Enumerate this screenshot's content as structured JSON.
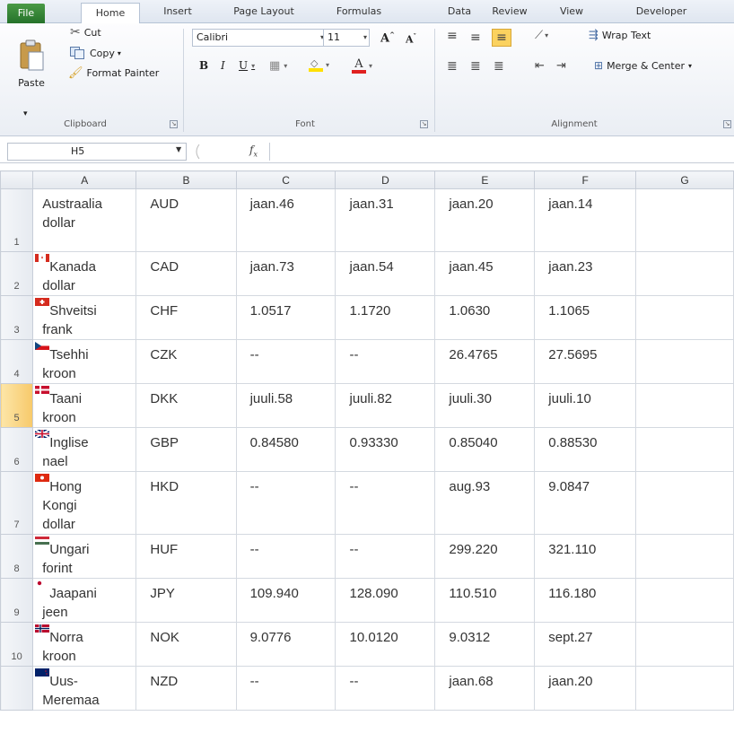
{
  "tabs": [
    "File",
    "Home",
    "Insert",
    "Page Layout",
    "Formulas",
    "Data",
    "Review",
    "View",
    "Developer"
  ],
  "clipboard": {
    "paste": "Paste",
    "cut": "Cut",
    "copy": "Copy",
    "format_painter": "Format Painter",
    "label": "Clipboard"
  },
  "font": {
    "name": "Calibri",
    "size": "11",
    "label": "Font"
  },
  "alignment": {
    "wrap": "Wrap Text",
    "merge": "Merge & Center",
    "label": "Alignment"
  },
  "formula_bar": {
    "name_box": "H5",
    "fx": "fx",
    "formula": ""
  },
  "columns": [
    "A",
    "B",
    "C",
    "D",
    "E",
    "F",
    "G"
  ],
  "selected_cell": {
    "column": "H",
    "row": 5
  },
  "rows": [
    {
      "num": "1",
      "flag": "",
      "name": [
        "Austraalia",
        "dollar"
      ],
      "code": "AUD",
      "c": "jaan.46",
      "d": "jaan.31",
      "e": "jaan.20",
      "f": "jaan.14"
    },
    {
      "num": "2",
      "flag": "ca",
      "name": [
        "Kanada",
        "dollar"
      ],
      "code": "CAD",
      "c": "jaan.73",
      "d": "jaan.54",
      "e": "jaan.45",
      "f": "jaan.23"
    },
    {
      "num": "3",
      "flag": "ch",
      "name": [
        "Shveitsi",
        "frank"
      ],
      "code": "CHF",
      "c": "1.0517",
      "d": "1.1720",
      "e": "1.0630",
      "f": "1.1065"
    },
    {
      "num": "4",
      "flag": "cz",
      "name": [
        "Tsehhi",
        "kroon"
      ],
      "code": "CZK",
      "c": "--",
      "d": "--",
      "e": "26.4765",
      "f": "27.5695"
    },
    {
      "num": "5",
      "flag": "dk",
      "name": [
        "Taani",
        "kroon"
      ],
      "code": "DKK",
      "c": "juuli.58",
      "d": "juuli.82",
      "e": "juuli.30",
      "f": "juuli.10"
    },
    {
      "num": "6",
      "flag": "gb",
      "name": [
        "Inglise",
        "nael"
      ],
      "code": "GBP",
      "c": "0.84580",
      "d": "0.93330",
      "e": "0.85040",
      "f": "0.88530"
    },
    {
      "num": "7",
      "flag": "hk",
      "name": [
        "Hong",
        "Kongi",
        "dollar"
      ],
      "code": "HKD",
      "c": "--",
      "d": "--",
      "e": "aug.93",
      "f": "9.0847"
    },
    {
      "num": "8",
      "flag": "hu",
      "name": [
        "Ungari",
        "forint"
      ],
      "code": "HUF",
      "c": "--",
      "d": "--",
      "e": "299.220",
      "f": "321.110"
    },
    {
      "num": "9",
      "flag": "jp",
      "name": [
        "Jaapani",
        "jeen"
      ],
      "code": "JPY",
      "c": "109.940",
      "d": "128.090",
      "e": "110.510",
      "f": "116.180"
    },
    {
      "num": "10",
      "flag": "no",
      "name": [
        "Norra",
        "kroon"
      ],
      "code": "NOK",
      "c": "9.0776",
      "d": "10.0120",
      "e": "9.0312",
      "f": "sept.27"
    },
    {
      "num": "",
      "flag": "nz",
      "name": [
        "Uus-",
        "Meremaa"
      ],
      "code": "NZD",
      "c": "--",
      "d": "--",
      "e": "jaan.68",
      "f": "jaan.20"
    }
  ]
}
